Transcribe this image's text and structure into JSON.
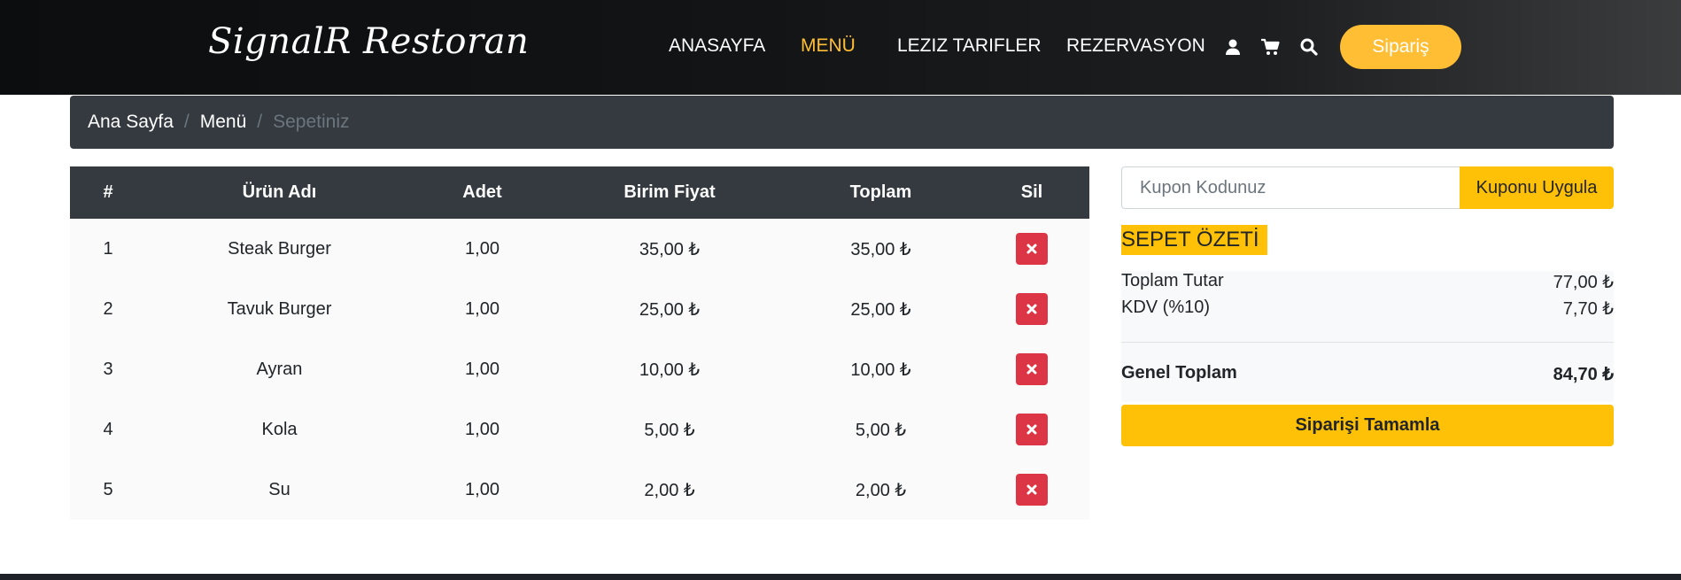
{
  "header": {
    "brand": "SignalR Restoran",
    "nav": [
      {
        "label": "ANASAYFA",
        "active": false
      },
      {
        "label": "MENÜ",
        "active": true
      },
      {
        "label": "LEZIZ TARIFLER",
        "active": false
      },
      {
        "label": "REZERVASYON",
        "active": false
      }
    ],
    "icons": [
      "user-icon",
      "cart-icon",
      "search-icon"
    ],
    "order_button": "Sipariş"
  },
  "breadcrumb": {
    "home": "Ana Sayfa",
    "menu": "Menü",
    "current": "Sepetiniz",
    "separator": "/"
  },
  "table": {
    "headers": [
      "#",
      "Ürün Adı",
      "Adet",
      "Birim Fiyat",
      "Toplam",
      "Sil"
    ],
    "rows": [
      {
        "no": "1",
        "name": "Steak Burger",
        "qty": "1,00",
        "unit_price": "35,00 ₺",
        "total": "35,00 ₺"
      },
      {
        "no": "2",
        "name": "Tavuk Burger",
        "qty": "1,00",
        "unit_price": "25,00 ₺",
        "total": "25,00 ₺"
      },
      {
        "no": "3",
        "name": "Ayran",
        "qty": "1,00",
        "unit_price": "10,00 ₺",
        "total": "10,00 ₺"
      },
      {
        "no": "4",
        "name": "Kola",
        "qty": "1,00",
        "unit_price": "5,00 ₺",
        "total": "5,00 ₺"
      },
      {
        "no": "5",
        "name": "Su",
        "qty": "1,00",
        "unit_price": "2,00 ₺",
        "total": "2,00 ₺"
      }
    ],
    "delete_icon": "close-icon"
  },
  "coupon": {
    "placeholder": "Kupon Kodunuz",
    "value": "",
    "button": "Kuponu Uygula"
  },
  "summary": {
    "title": "SEPET ÖZETİ",
    "subtotal_label": "Toplam Tutar",
    "subtotal_value": "77,00 ₺",
    "tax_label": "KDV (%10)",
    "tax_value": "7,70 ₺",
    "grand_label": "Genel Toplam",
    "grand_value": "84,70 ₺",
    "complete_button": "Siparişi Tamamla"
  },
  "colors": {
    "accent": "#ffbe33",
    "warning": "#ffc107",
    "danger": "#dc3545",
    "dark": "#343a40"
  }
}
